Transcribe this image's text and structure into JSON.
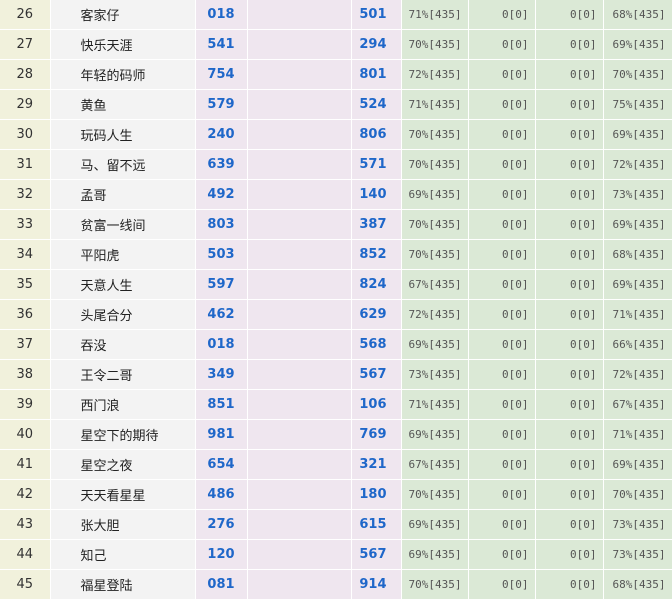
{
  "rows": [
    {
      "rank": "26",
      "name": "客家仔",
      "num1": "018",
      "num2": "501",
      "s1": "71%[435]",
      "s2": "0[0]",
      "s3": "0[0]",
      "s4": "68%[435]"
    },
    {
      "rank": "27",
      "name": "快乐天涯",
      "num1": "541",
      "num2": "294",
      "s1": "70%[435]",
      "s2": "0[0]",
      "s3": "0[0]",
      "s4": "69%[435]"
    },
    {
      "rank": "28",
      "name": "年轻的码师",
      "num1": "754",
      "num2": "801",
      "s1": "72%[435]",
      "s2": "0[0]",
      "s3": "0[0]",
      "s4": "70%[435]"
    },
    {
      "rank": "29",
      "name": "黄鱼",
      "num1": "579",
      "num2": "524",
      "s1": "71%[435]",
      "s2": "0[0]",
      "s3": "0[0]",
      "s4": "75%[435]"
    },
    {
      "rank": "30",
      "name": "玩码人生",
      "num1": "240",
      "num2": "806",
      "s1": "70%[435]",
      "s2": "0[0]",
      "s3": "0[0]",
      "s4": "69%[435]"
    },
    {
      "rank": "31",
      "name": "马、留不远",
      "num1": "639",
      "num2": "571",
      "s1": "70%[435]",
      "s2": "0[0]",
      "s3": "0[0]",
      "s4": "72%[435]"
    },
    {
      "rank": "32",
      "name": "孟哥",
      "num1": "492",
      "num2": "140",
      "s1": "69%[435]",
      "s2": "0[0]",
      "s3": "0[0]",
      "s4": "73%[435]"
    },
    {
      "rank": "33",
      "name": "贫富一线间",
      "num1": "803",
      "num2": "387",
      "s1": "70%[435]",
      "s2": "0[0]",
      "s3": "0[0]",
      "s4": "69%[435]"
    },
    {
      "rank": "34",
      "name": "平阳虎",
      "num1": "503",
      "num2": "852",
      "s1": "70%[435]",
      "s2": "0[0]",
      "s3": "0[0]",
      "s4": "68%[435]"
    },
    {
      "rank": "35",
      "name": "天意人生",
      "num1": "597",
      "num2": "824",
      "s1": "67%[435]",
      "s2": "0[0]",
      "s3": "0[0]",
      "s4": "69%[435]"
    },
    {
      "rank": "36",
      "name": "头尾合分",
      "num1": "462",
      "num2": "629",
      "s1": "72%[435]",
      "s2": "0[0]",
      "s3": "0[0]",
      "s4": "71%[435]"
    },
    {
      "rank": "37",
      "name": "吞没",
      "num1": "018",
      "num2": "568",
      "s1": "69%[435]",
      "s2": "0[0]",
      "s3": "0[0]",
      "s4": "66%[435]"
    },
    {
      "rank": "38",
      "name": "王令二哥",
      "num1": "349",
      "num2": "567",
      "s1": "73%[435]",
      "s2": "0[0]",
      "s3": "0[0]",
      "s4": "72%[435]"
    },
    {
      "rank": "39",
      "name": "西门浪",
      "num1": "851",
      "num2": "106",
      "s1": "71%[435]",
      "s2": "0[0]",
      "s3": "0[0]",
      "s4": "67%[435]"
    },
    {
      "rank": "40",
      "name": "星空下的期待",
      "num1": "981",
      "num2": "769",
      "s1": "69%[435]",
      "s2": "0[0]",
      "s3": "0[0]",
      "s4": "71%[435]"
    },
    {
      "rank": "41",
      "name": "星空之夜",
      "num1": "654",
      "num2": "321",
      "s1": "67%[435]",
      "s2": "0[0]",
      "s3": "0[0]",
      "s4": "69%[435]"
    },
    {
      "rank": "42",
      "name": "天天看星星",
      "num1": "486",
      "num2": "180",
      "s1": "70%[435]",
      "s2": "0[0]",
      "s3": "0[0]",
      "s4": "70%[435]"
    },
    {
      "rank": "43",
      "name": "张大胆",
      "num1": "276",
      "num2": "615",
      "s1": "69%[435]",
      "s2": "0[0]",
      "s3": "0[0]",
      "s4": "73%[435]"
    },
    {
      "rank": "44",
      "name": "知己",
      "num1": "120",
      "num2": "567",
      "s1": "69%[435]",
      "s2": "0[0]",
      "s3": "0[0]",
      "s4": "73%[435]"
    },
    {
      "rank": "45",
      "name": "福星登陆",
      "num1": "081",
      "num2": "914",
      "s1": "70%[435]",
      "s2": "0[0]",
      "s3": "0[0]",
      "s4": "68%[435]"
    }
  ]
}
